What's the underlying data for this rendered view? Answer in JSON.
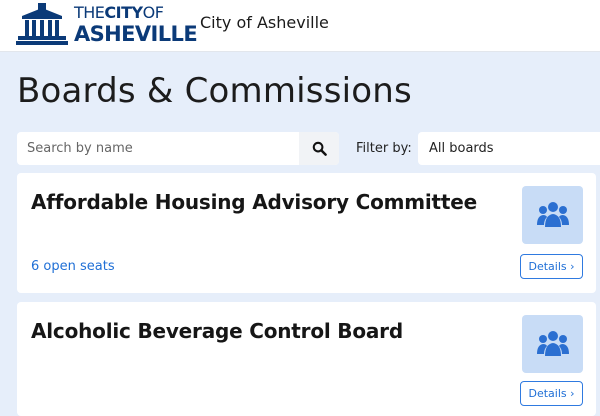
{
  "header": {
    "logo_line1_pre": "THE",
    "logo_line1_bold": "CITY",
    "logo_line1_post": "OF",
    "logo_line2": "ASHEVILLE",
    "brand": "City of Asheville"
  },
  "page": {
    "title": "Boards & Commissions"
  },
  "search": {
    "placeholder": "Search by name",
    "value": ""
  },
  "filter": {
    "label": "Filter by:",
    "selected": "All boards"
  },
  "cards": [
    {
      "title": "Affordable Housing Advisory Committee",
      "seats": "6 open seats",
      "details_label": "Details ›"
    },
    {
      "title": "Alcoholic Beverage Control Board",
      "seats": "",
      "details_label": "Details ›"
    }
  ],
  "icons": {
    "search": "search-icon",
    "board": "users-group-icon",
    "logo": "city-hall-icon"
  },
  "colors": {
    "brand": "#0b3a78",
    "accent": "#1f6fd6",
    "icon_bg": "#c8dcf6",
    "page_bg": "#e6eefa"
  }
}
